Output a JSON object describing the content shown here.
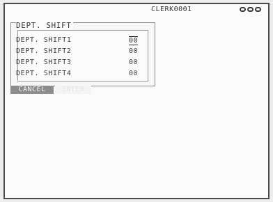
{
  "header": {
    "clerk": "CLERK0001",
    "status_icon": "double-ring-icon"
  },
  "dialog": {
    "title": "DEPT. SHIFT",
    "rows": [
      {
        "label": "DEPT. SHIFT1",
        "value": "00"
      },
      {
        "label": "DEPT. SHIFT2",
        "value": "00"
      },
      {
        "label": "DEPT. SHIFT3",
        "value": "00"
      },
      {
        "label": "DEPT. SHIFT4",
        "value": "00"
      }
    ],
    "buttons": {
      "cancel": "CANCEL",
      "enter": "ENTER"
    }
  }
}
